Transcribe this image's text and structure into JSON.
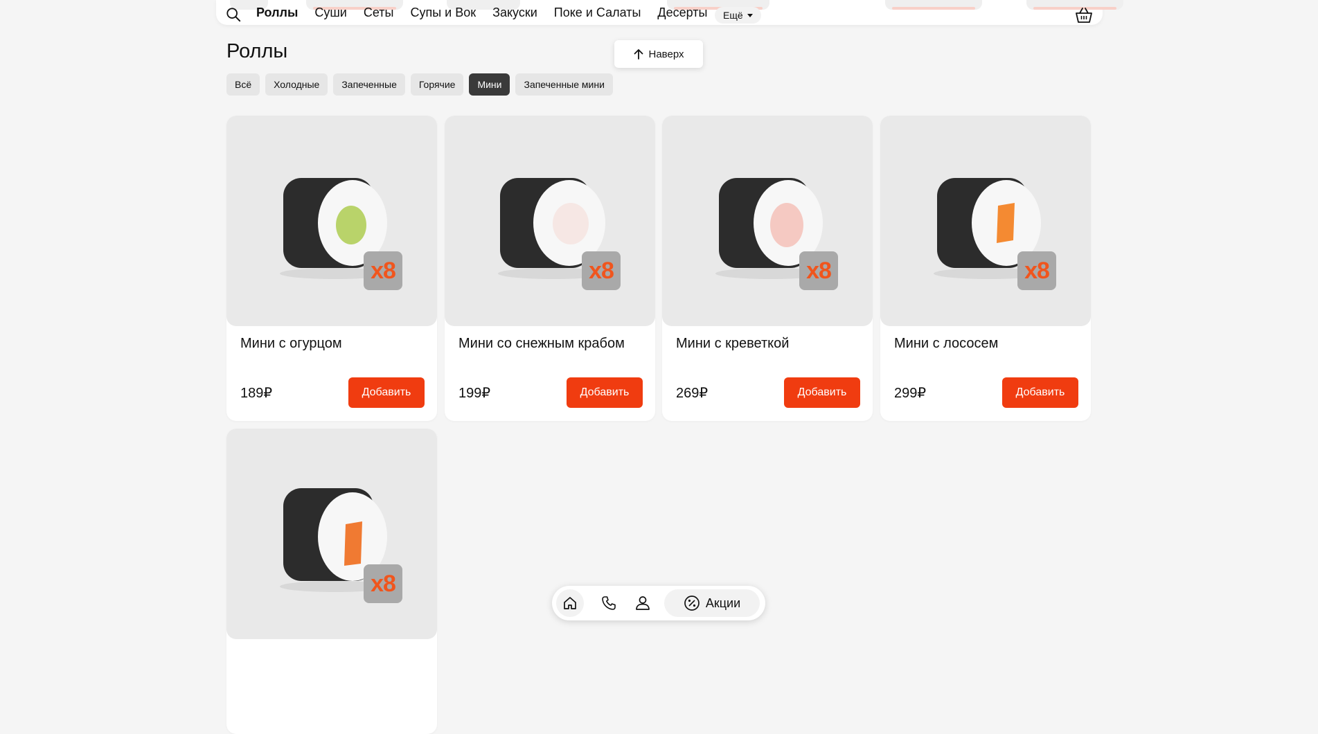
{
  "header": {
    "search_icon": "search-icon",
    "categories": [
      "Роллы",
      "Суши",
      "Сеты",
      "Супы и Вок",
      "Закуски",
      "Поке и Салаты",
      "Десерты"
    ],
    "more_label": "Ещё",
    "basket_icon": "basket-icon"
  },
  "scroll_top": {
    "label": "Наверх"
  },
  "section": {
    "title": "Роллы",
    "filters": [
      "Всё",
      "Холодные",
      "Запеченные",
      "Горячие",
      "Мини",
      "Запеченные мини"
    ],
    "active_filter": "Мини"
  },
  "products": [
    {
      "name": "Мини с огурцом",
      "price": "189₽",
      "badge": "x8",
      "add_label": "Добавить",
      "filling_color": "#b9d36a"
    },
    {
      "name": "Мини со снежным крабом",
      "price": "199₽",
      "badge": "x8",
      "add_label": "Добавить",
      "filling_color": "#f6e7e4"
    },
    {
      "name": "Мини с креветкой",
      "price": "269₽",
      "badge": "x8",
      "add_label": "Добавить",
      "filling_color": "#f5c9c2"
    },
    {
      "name": "Мини с лососем",
      "price": "299₽",
      "badge": "x8",
      "add_label": "Добавить",
      "filling_color": "#f48a32"
    },
    {
      "name": "",
      "price": "",
      "badge": "x8",
      "add_label": "",
      "filling_color": "#f07a32"
    }
  ],
  "dock": {
    "home_icon": "home-icon",
    "phone_icon": "phone-icon",
    "profile_icon": "profile-icon",
    "promo_label": "Акции",
    "promo_icon": "percent-icon"
  },
  "colors": {
    "accent": "#f03c10",
    "background": "#f5f5f5",
    "active_chip": "#3a3a3a"
  }
}
